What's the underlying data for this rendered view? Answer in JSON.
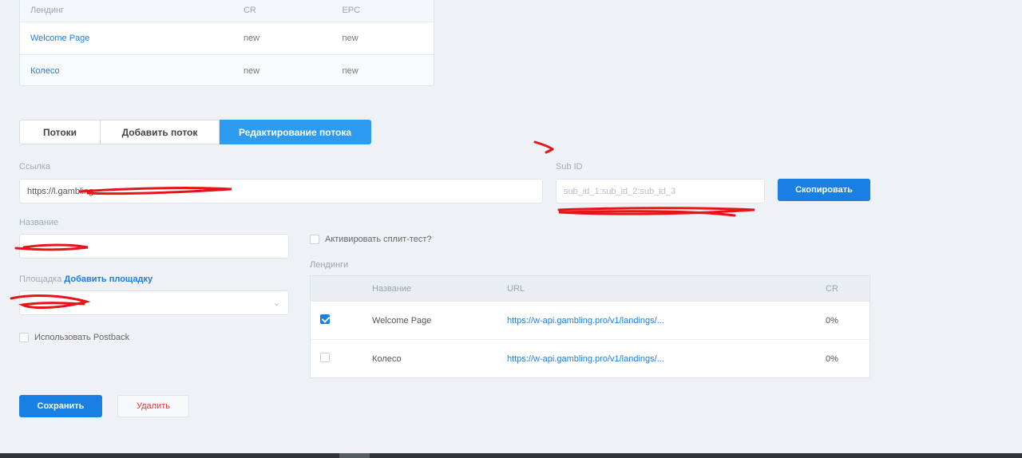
{
  "top_table": {
    "headers": [
      "Лендинг",
      "CR",
      "EPC"
    ],
    "rows": [
      {
        "name": "Welcome Page",
        "cr": "new",
        "epc": "new"
      },
      {
        "name": "Колесо",
        "cr": "new",
        "epc": "new"
      }
    ]
  },
  "tabs": [
    {
      "label": "Потоки"
    },
    {
      "label": "Добавить поток"
    },
    {
      "label": "Редактирование потока",
      "active": true
    }
  ],
  "form": {
    "link_label": "Ссылка",
    "link_value": "https://l.gambling...",
    "subid_label": "Sub ID",
    "subid_placeholder": "sub_id_1:sub_id_2:sub_id_3",
    "copy_button": "Скопировать",
    "name_label": "Название",
    "name_value": "",
    "platform_label": "Площадка",
    "platform_add_link": "Добавить площадку",
    "platform_value": "",
    "postback_label": "Использовать Postback",
    "split_label": "Активировать сплит-тест?",
    "landings_label": "Лендинги"
  },
  "landings_table": {
    "headers": [
      "Название",
      "URL",
      "CR"
    ],
    "rows": [
      {
        "checked": true,
        "name": "Welcome Page",
        "url": "https://w-api.gambling.pro/v1/landings/...",
        "cr": "0%"
      },
      {
        "checked": false,
        "name": "Колесо",
        "url": "https://w-api.gambling.pro/v1/landings/...",
        "cr": "0%"
      }
    ]
  },
  "actions": {
    "save": "Сохранить",
    "delete": "Удалить"
  },
  "colors": {
    "accent": "#1a7fe3",
    "active_tab": "#2d9cf0",
    "danger": "#e03a3a",
    "scribble": "#e8141a"
  }
}
